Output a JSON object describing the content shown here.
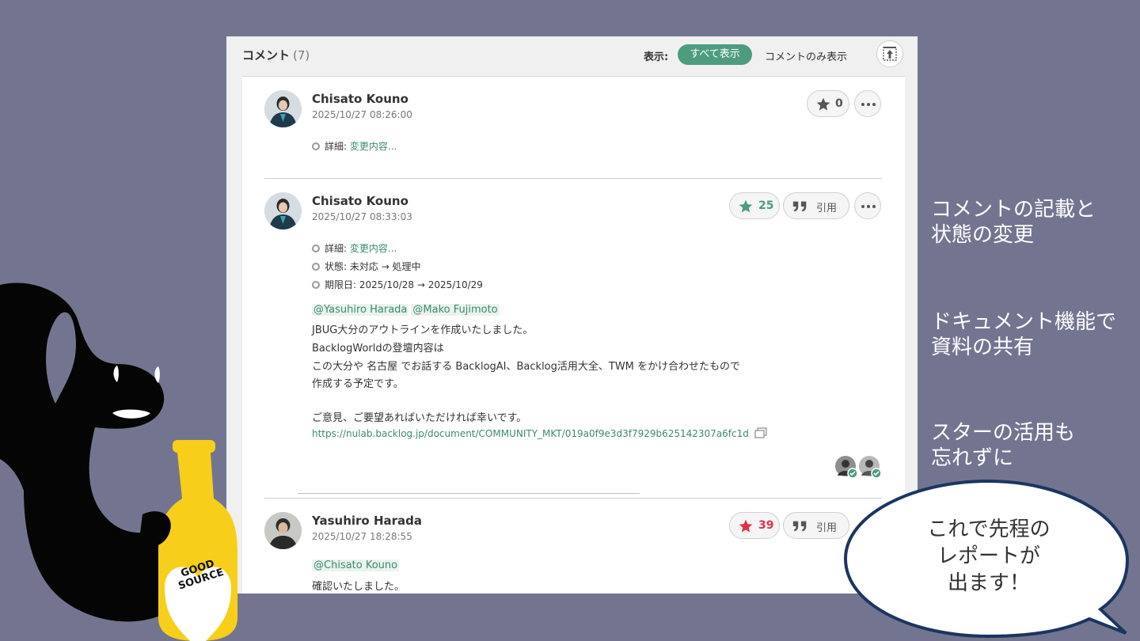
{
  "panel": {
    "title": "コメント",
    "count": "(7)",
    "filter_label": "表示:",
    "filter_all": "すべて表示",
    "filter_comments_only": "コメントのみ表示"
  },
  "comments": [
    {
      "author": "Chisato Kouno",
      "date": "2025/10/27 08:26:00",
      "star_count": "0",
      "changes": [
        {
          "label": "詳細:",
          "value": "変更内容..."
        }
      ]
    },
    {
      "author": "Chisato Kouno",
      "date": "2025/10/27 08:33:03",
      "star_count": "25",
      "quote_label": "引用",
      "changes": [
        {
          "label": "詳細:",
          "value": "変更内容..."
        },
        {
          "label": "状態:",
          "value": "未対応 → 処理中"
        },
        {
          "label": "期限日:",
          "value": "2025/10/28 → 2025/10/29"
        }
      ],
      "mentions": [
        "@Yasuhiro Harada",
        "@Mako Fujimoto"
      ],
      "lines": [
        "JBUG大分のアウトラインを作成いたしました。",
        "BacklogWorldの登壇内容は",
        "この大分や 名古屋 でお話する BacklogAI、Backlog活用大全、TWM をかけ合わせたもので",
        "作成する予定です。",
        "ご意見、ご要望あればいただければ幸いです。"
      ],
      "url": "https://nulab.backlog.jp/document/COMMUNITY_MKT/019a0f9e3d3f7929b625142307a6fc1d"
    },
    {
      "author": "Yasuhiro Harada",
      "date": "2025/10/27 18:28:55",
      "star_count": "39",
      "quote_label": "引用",
      "mentions": [
        "@Chisato Kouno"
      ],
      "lines": [
        "確認いたしました。"
      ]
    }
  ],
  "annotations": {
    "note1": [
      "コメントの記載と",
      "状態の変更"
    ],
    "note2": [
      "ドキュメント機能で",
      "資料の共有"
    ],
    "note3": [
      "スターの活用も",
      "忘れずに"
    ],
    "bubble": [
      "これで先程の",
      "レポートが",
      "出ます！"
    ]
  },
  "mascot": {
    "label_line1": "GOOD",
    "label_line2": "SOURCE"
  },
  "colors": {
    "background": "#737590",
    "accent": "#4e9c80",
    "star_green": "#4e9c80",
    "star_red": "#e0314b",
    "bottle": "#f7cf1a"
  }
}
